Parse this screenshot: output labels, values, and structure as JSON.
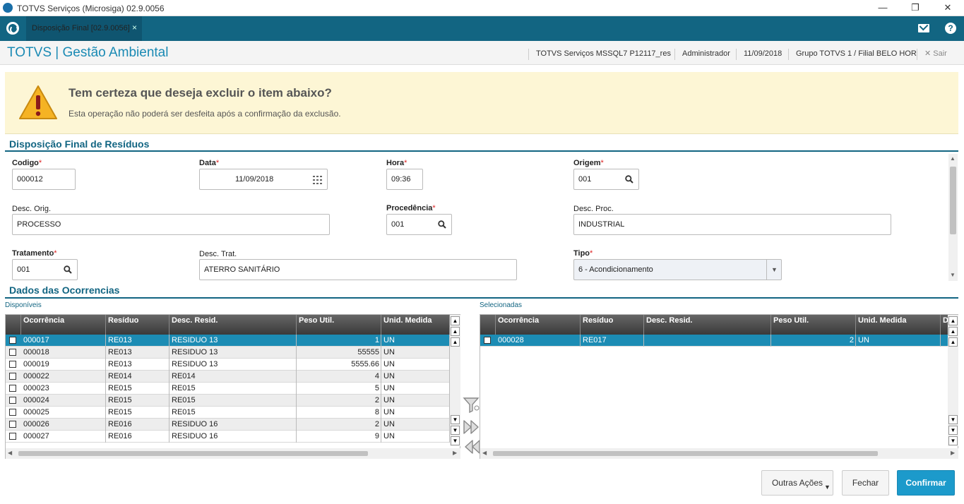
{
  "window": {
    "title": "TOTVS Serviços (Microsiga) 02.9.0056"
  },
  "tab": {
    "label": "Disposição Final [02.9.0056]",
    "close": "×"
  },
  "header": {
    "brand": "TOTVS | Gestão Ambiental",
    "server": "TOTVS Serviços MSSQL7 P12117_res",
    "user": "Administrador",
    "date": "11/09/2018",
    "group": "Grupo TOTVS 1 / Filial BELO HOR",
    "exit": "Sair"
  },
  "warning": {
    "question": "Tem certeza que deseja excluir o item abaixo?",
    "detail": "Esta operação não poderá ser desfeita após a confirmação da exclusão."
  },
  "form": {
    "section_title": "Disposição Final de Resíduos",
    "codigo": {
      "label": "Codigo",
      "value": "000012"
    },
    "data": {
      "label": "Data",
      "value": "11/09/2018"
    },
    "hora": {
      "label": "Hora",
      "value": "09:36"
    },
    "origem": {
      "label": "Origem",
      "value": "001"
    },
    "desc_orig": {
      "label": "Desc. Orig.",
      "value": "PROCESSO"
    },
    "procedencia": {
      "label": "Procedência",
      "value": "001"
    },
    "desc_proc": {
      "label": "Desc. Proc.",
      "value": "INDUSTRIAL"
    },
    "tratamento": {
      "label": "Tratamento",
      "value": "001"
    },
    "desc_trat": {
      "label": "Desc. Trat.",
      "value": "ATERRO SANITÁRIO"
    },
    "tipo": {
      "label": "Tipo",
      "value": "6 - Acondicionamento"
    },
    "required_mark": "*"
  },
  "ocorrencias": {
    "section_title": "Dados das Ocorrencias",
    "available_label": "Disponíveis",
    "selected_label": "Selecionadas",
    "columns": [
      "Ocorrência",
      "Resíduo",
      "Desc. Resid.",
      "Peso Util.",
      "Unid. Medida"
    ],
    "selected_columns": [
      "Ocorrência",
      "Resíduo",
      "Desc. Resid.",
      "Peso Util.",
      "Unid. Medida",
      "D"
    ],
    "available": [
      [
        "000017",
        "RE013",
        "RESIDUO 13",
        "1",
        "UN"
      ],
      [
        "000018",
        "RE013",
        "RESIDUO 13",
        "55555",
        "UN"
      ],
      [
        "000019",
        "RE013",
        "RESIDUO 13",
        "5555.66",
        "UN"
      ],
      [
        "000022",
        "RE014",
        "RE014",
        "4",
        "UN"
      ],
      [
        "000023",
        "RE015",
        "RE015",
        "5",
        "UN"
      ],
      [
        "000024",
        "RE015",
        "RE015",
        "2",
        "UN"
      ],
      [
        "000025",
        "RE015",
        "RE015",
        "8",
        "UN"
      ],
      [
        "000026",
        "RE016",
        "RESIDUO 16",
        "2",
        "UN"
      ],
      [
        "000027",
        "RE016",
        "RESIDUO 16",
        "9",
        "UN"
      ]
    ],
    "selected": [
      [
        "000028",
        "RE017",
        "",
        "2",
        "UN"
      ]
    ]
  },
  "buttons": {
    "other_actions": "Outras Ações",
    "close": "Fechar",
    "confirm": "Confirmar"
  },
  "colors": {
    "brand": "#126582",
    "accent": "#1c8cb4",
    "warning_bg": "#fdf6d5"
  }
}
